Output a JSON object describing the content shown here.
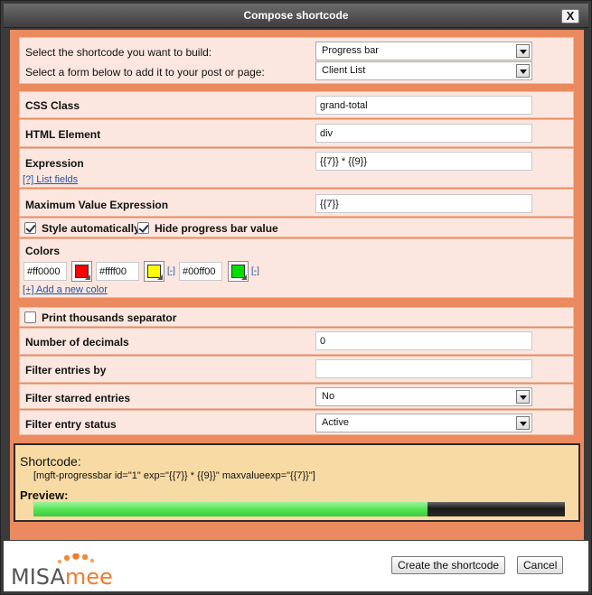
{
  "dialog": {
    "title": "Compose shortcode",
    "close_label": "X"
  },
  "form": {
    "shortcode_label": "Select the shortcode you want to build:",
    "shortcode_value": "Progress bar",
    "form_label": "Select a form below to add it to your post or page:",
    "form_value": "Client List",
    "css_class_label": "CSS Class",
    "css_class_value": "grand-total",
    "html_element_label": "HTML Element",
    "html_element_value": "div",
    "expression_label": "Expression",
    "expression_value": "{{7}} * {{9}}",
    "list_fields_link": "[?] List fields",
    "max_value_label": "Maximum Value Expression",
    "max_value_value": "{{7}}",
    "style_auto_label": "Style automatically",
    "hide_value_label": "Hide progress bar value",
    "colors_label": "Colors",
    "colors": [
      {
        "value": "#ff0000",
        "swatch": "#ff0000",
        "remove": ""
      },
      {
        "value": "#ffff00",
        "swatch": "#ffff00",
        "remove": "[-]"
      },
      {
        "value": "#00ff00",
        "swatch": "#00e000",
        "remove": "[-]"
      }
    ],
    "add_color_link": "[+] Add a new color",
    "thousands_label": "Print thousands separator",
    "decimals_label": "Number of decimals",
    "decimals_value": "0",
    "filter_entries_label": "Filter entries by",
    "filter_entries_value": "",
    "filter_starred_label": "Filter starred entries",
    "filter_starred_value": "No",
    "filter_status_label": "Filter entry status",
    "filter_status_value": "Active"
  },
  "output": {
    "shortcode_title": "Shortcode:",
    "shortcode_text": "[mgft-progressbar id=\"1\" exp=\"{{7}} * {{9}}\" maxvalueexp=\"{{7}}\"]",
    "preview_title": "Preview:",
    "progress_fraction": 0.742
  },
  "footer": {
    "logo_part1": "MISA",
    "logo_part2": "mee",
    "create_label": "Create the shortcode",
    "cancel_label": "Cancel"
  }
}
